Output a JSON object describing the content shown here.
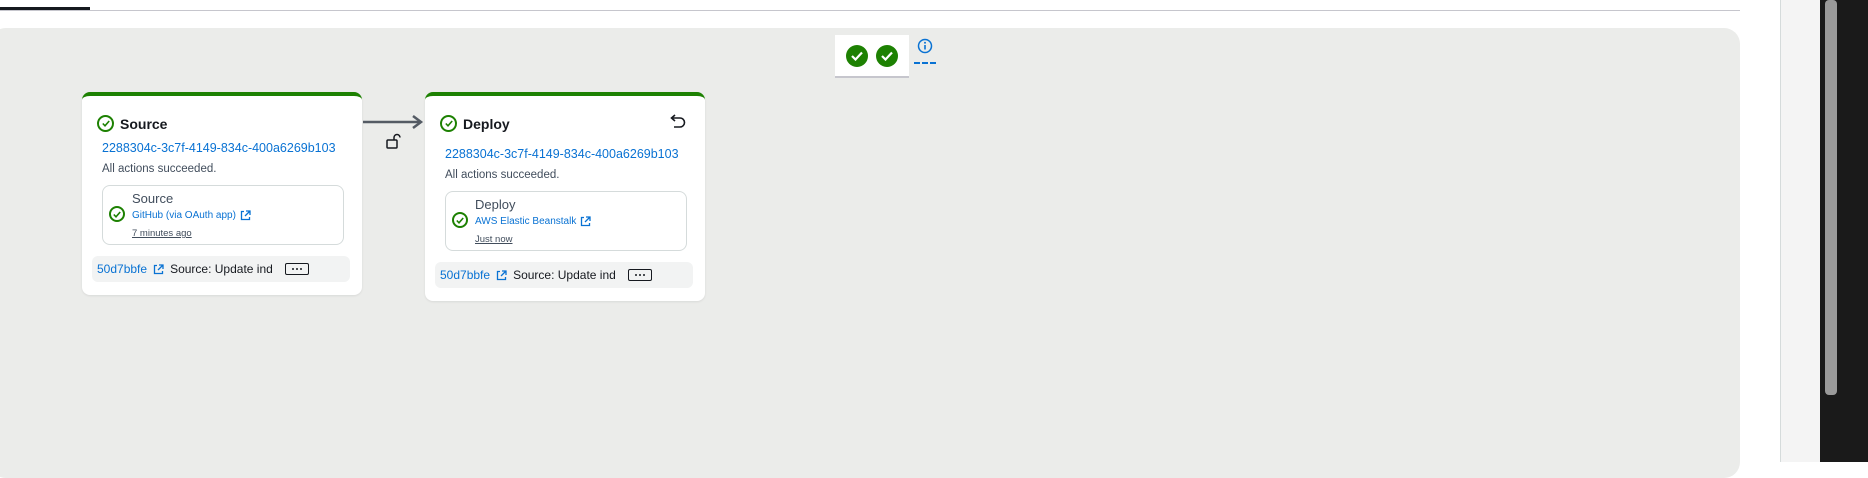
{
  "summary": {
    "status_icons": [
      "check-circle-icon",
      "check-circle-icon"
    ]
  },
  "stages": [
    {
      "name": "Source",
      "execution_id": "2288304c-3c7f-4149-834c-400a6269b103",
      "status": "All actions succeeded.",
      "action": {
        "name": "Source",
        "provider": "GitHub (via OAuth app)",
        "time": "7 minutes ago"
      },
      "commit": {
        "id": "50d7bbfe",
        "message": "Source: Update ind"
      }
    },
    {
      "name": "Deploy",
      "execution_id": "2288304c-3c7f-4149-834c-400a6269b103",
      "status": "All actions succeeded.",
      "action": {
        "name": "Deploy",
        "provider": "AWS Elastic Beanstalk",
        "time": "Just now"
      },
      "commit": {
        "id": "50d7bbfe",
        "message": "Source: Update ind"
      }
    }
  ],
  "colors": {
    "success": "#1d8102",
    "link": "#0972d3",
    "canvas": "#ebecea"
  }
}
